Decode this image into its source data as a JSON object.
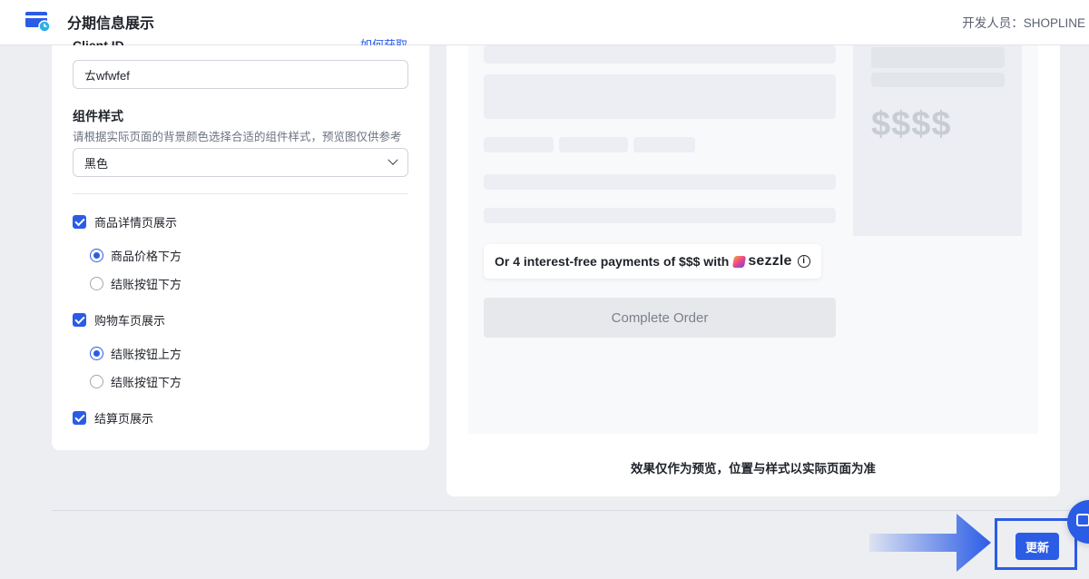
{
  "header": {
    "title": "分期信息展示",
    "developer_label": "开发人员：SHOPLINE"
  },
  "settings": {
    "client_id_label": "Client ID",
    "howto_link": "如何获取",
    "client_id_value": "ㄊwfwfef",
    "style_title": "组件样式",
    "style_desc": "请根据实际页面的背景颜色选择合适的组件样式，预览图仅供参考",
    "style_selected": "黑色",
    "product_page": {
      "label": "商品详情页展示",
      "checked": true,
      "options": [
        {
          "label": "商品价格下方",
          "selected": true
        },
        {
          "label": "结账按钮下方",
          "selected": false
        }
      ]
    },
    "cart_page": {
      "label": "购物车页展示",
      "checked": true,
      "options": [
        {
          "label": "结账按钮上方",
          "selected": true
        },
        {
          "label": "结账按钮下方",
          "selected": false
        }
      ]
    },
    "checkout_page": {
      "label": "结算页展示",
      "checked": true
    }
  },
  "preview": {
    "price_placeholder": "$$$$",
    "sezzle_text": "Or 4 interest-free payments of $$$ with",
    "sezzle_brand": "sezzle",
    "info_glyph": "i",
    "complete_order": "Complete Order",
    "note": "效果仅作为预览，位置与样式以实际页面为准"
  },
  "footer": {
    "update_button": "更新"
  },
  "colors": {
    "accent": "#2b5ce6",
    "page_bg": "#eceef2",
    "skeleton": "#eceef3"
  }
}
